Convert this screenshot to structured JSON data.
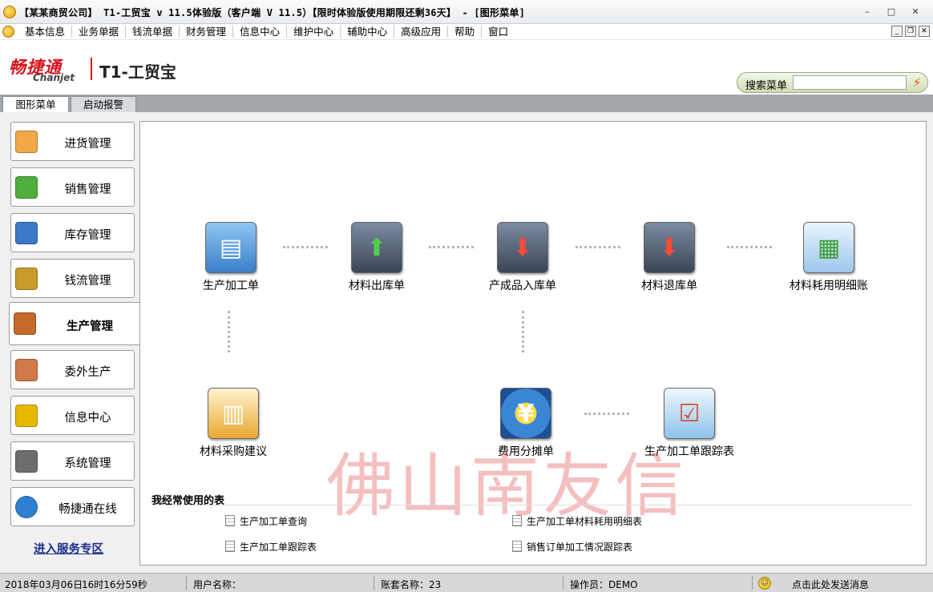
{
  "window": {
    "title": "【某某商贸公司】 T1-工贸宝 v 11.5体验版（客户端 V 11.5）【限时体验版使用期限还剩36天】 - [图形菜单]",
    "controls": [
      "–",
      "□",
      "✕"
    ]
  },
  "menu": {
    "items": [
      "基本信息",
      "业务单据",
      "钱流单据",
      "财务管理",
      "信息中心",
      "维护中心",
      "辅助中心",
      "高级应用",
      "帮助",
      "窗口"
    ],
    "mdi_controls": [
      "_",
      "❐",
      "✕"
    ]
  },
  "brand": {
    "logo_cn": "畅捷通",
    "logo_en": "Chanjet",
    "product": "T1-工贸宝"
  },
  "search": {
    "label": "搜索菜单",
    "value": "",
    "go_icon": "⚡"
  },
  "tabs": [
    {
      "label": "图形菜单",
      "active": true
    },
    {
      "label": "启动报警",
      "active": false
    }
  ],
  "nav": {
    "items": [
      {
        "label": "进货管理",
        "icon": "purchase-icon",
        "color": "#f0a848"
      },
      {
        "label": "销售管理",
        "icon": "sales-basket-icon",
        "color": "#4fae3c"
      },
      {
        "label": "库存管理",
        "icon": "inventory-icon",
        "color": "#3a78c8"
      },
      {
        "label": "钱流管理",
        "icon": "cashflow-icon",
        "color": "#c99b2b"
      },
      {
        "label": "生产管理",
        "icon": "production-icon",
        "color": "#c46a2a"
      },
      {
        "label": "委外生产",
        "icon": "outsourcing-icon",
        "color": "#d2794a"
      },
      {
        "label": "信息中心",
        "icon": "info-center-icon",
        "color": "#e6b800"
      },
      {
        "label": "系统管理",
        "icon": "system-settings-icon",
        "color": "#6d6d6d"
      },
      {
        "label": "畅捷通在线",
        "icon": "online-globe-icon",
        "color": "#2f7fd2"
      }
    ],
    "service_link": "进入服务专区"
  },
  "flow": {
    "items": [
      {
        "label": "生产加工单",
        "icon": "production-order-icon",
        "glyph": "▤",
        "color": "#4a8fd8"
      },
      {
        "label": "材料出库单",
        "icon": "material-out-icon",
        "glyph": "⬆",
        "color": "#3aa84a"
      },
      {
        "label": "产成品入库单",
        "icon": "product-in-icon",
        "glyph": "⬇",
        "color": "#d83a2a"
      },
      {
        "label": "材料退库单",
        "icon": "material-return-icon",
        "glyph": "⬇",
        "color": "#d83a2a"
      },
      {
        "label": "材料耗用明细账",
        "icon": "material-usage-icon",
        "glyph": "▦",
        "color": "#4fae3c"
      },
      {
        "label": "材料采购建议",
        "icon": "purchase-suggestion-icon",
        "glyph": "▥",
        "color": "#e8a830"
      },
      {
        "label": "费用分摊单",
        "icon": "cost-allocation-icon",
        "glyph": "¥",
        "color": "#2f73c4"
      },
      {
        "label": "生产加工单跟踪表",
        "icon": "order-tracking-icon",
        "glyph": "☑",
        "color": "#5aa7d8"
      }
    ]
  },
  "watermark": "佛山南友信",
  "favorites": {
    "title": "我经常使用的表",
    "links": [
      "生产加工单查询",
      "生产加工单材料耗用明细表",
      "生产加工单跟踪表",
      "销售订单加工情况跟踪表"
    ]
  },
  "status": {
    "date": "2018年03月06日",
    "time": "16时16分59秒",
    "user_label": "用户名称：",
    "account_label": "账套名称：23",
    "operator_label": "操作员：DEMO",
    "message": "点击此处发送消息"
  }
}
